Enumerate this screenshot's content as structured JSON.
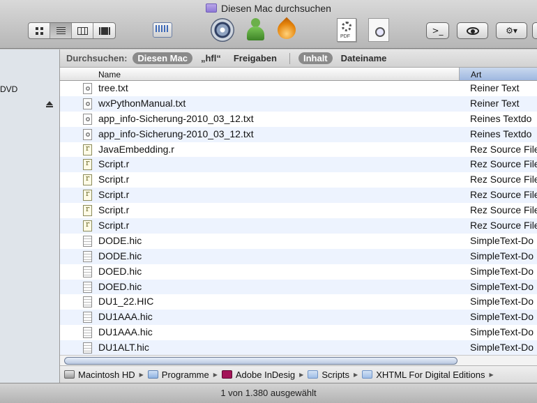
{
  "window": {
    "title": "Diesen Mac durchsuchen"
  },
  "toolbar": {
    "view_modes": [
      "icon-view",
      "list-view",
      "column-view",
      "cover-flow-view"
    ],
    "active_view": "list-view",
    "terminal_label": ">_"
  },
  "sidebar": {
    "item_label": "DVD"
  },
  "search": {
    "label": "Durchsuchen:",
    "scope_active": "Diesen Mac",
    "scope_user": "„hfl“",
    "scope_shared": "Freigaben",
    "attr_active": "Inhalt",
    "attr_filename": "Dateiname"
  },
  "columns": {
    "name": "Name",
    "kind": "Art"
  },
  "files": [
    {
      "name": "tree.txt",
      "kind": "Reiner Text",
      "icon": "text-file-icon"
    },
    {
      "name": "wxPythonManual.txt",
      "kind": "Reiner Text",
      "icon": "text-file-icon"
    },
    {
      "name": "app_info-Sicherung-2010_03_12.txt",
      "kind": "Reines Textdo",
      "icon": "text-file-icon"
    },
    {
      "name": "app_info-Sicherung-2010_03_12.txt",
      "kind": "Reines Textdo",
      "icon": "text-file-icon"
    },
    {
      "name": "JavaEmbedding.r",
      "kind": "Rez Source File",
      "icon": "rez-file-icon"
    },
    {
      "name": "Script.r",
      "kind": "Rez Source File",
      "icon": "rez-file-icon"
    },
    {
      "name": "Script.r",
      "kind": "Rez Source File",
      "icon": "rez-file-icon"
    },
    {
      "name": "Script.r",
      "kind": "Rez Source File",
      "icon": "rez-file-icon"
    },
    {
      "name": "Script.r",
      "kind": "Rez Source File",
      "icon": "rez-file-icon"
    },
    {
      "name": "Script.r",
      "kind": "Rez Source File",
      "icon": "rez-file-icon"
    },
    {
      "name": "DODE.hic",
      "kind": "SimpleText-Do",
      "icon": "simpletext-file-icon"
    },
    {
      "name": "DODE.hic",
      "kind": "SimpleText-Do",
      "icon": "simpletext-file-icon"
    },
    {
      "name": "DOED.hic",
      "kind": "SimpleText-Do",
      "icon": "simpletext-file-icon"
    },
    {
      "name": "DOED.hic",
      "kind": "SimpleText-Do",
      "icon": "simpletext-file-icon"
    },
    {
      "name": "DU1_22.HIC",
      "kind": "SimpleText-Do",
      "icon": "simpletext-file-icon"
    },
    {
      "name": "DU1AAA.hic",
      "kind": "SimpleText-Do",
      "icon": "simpletext-file-icon"
    },
    {
      "name": "DU1AAA.hic",
      "kind": "SimpleText-Do",
      "icon": "simpletext-file-icon"
    },
    {
      "name": "DU1ALT.hic",
      "kind": "SimpleText-Do",
      "icon": "simpletext-file-icon"
    }
  ],
  "pathbar": [
    {
      "label": "Macintosh HD",
      "icon": "hard-drive-icon"
    },
    {
      "label": "Programme",
      "icon": "applications-folder-icon"
    },
    {
      "label": "Adobe InDesig",
      "icon": "indesign-folder-icon"
    },
    {
      "label": "Scripts",
      "icon": "folder-icon"
    },
    {
      "label": "XHTML For Digital Editions",
      "icon": "folder-icon"
    }
  ],
  "status": {
    "text": "1 von 1.380 ausgewählt"
  }
}
